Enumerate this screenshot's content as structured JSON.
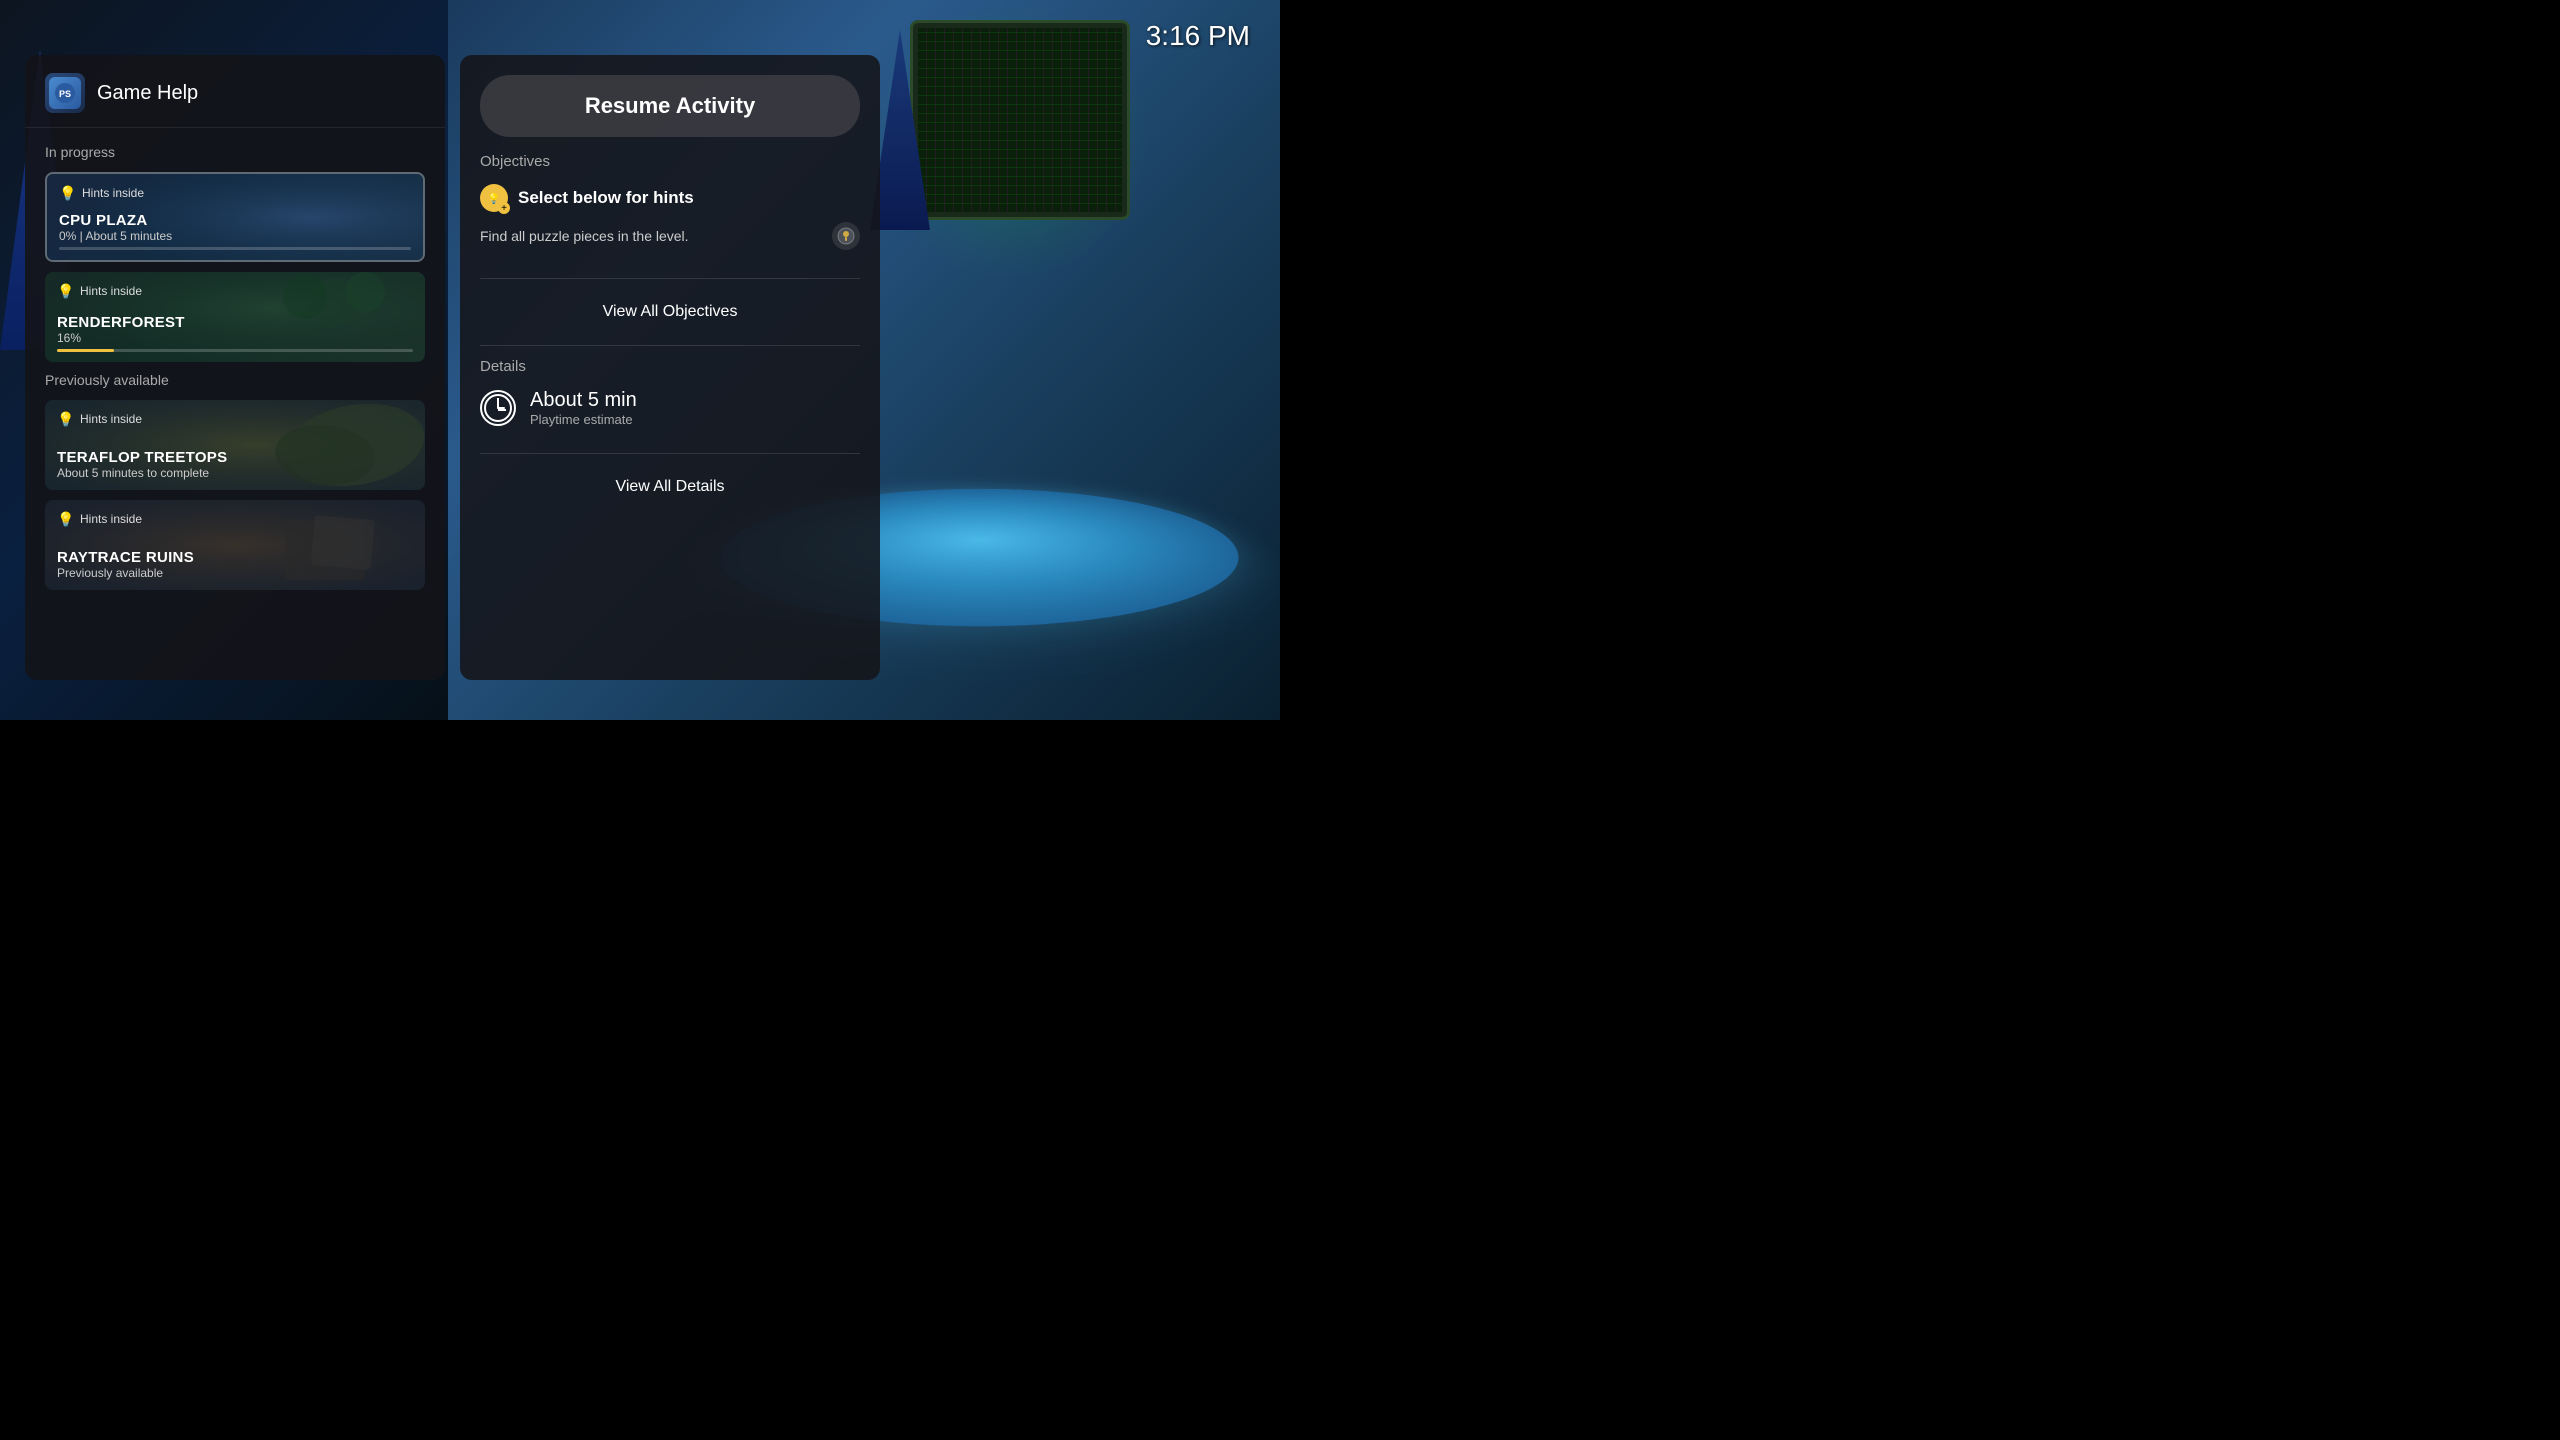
{
  "time": "3:16 PM",
  "header": {
    "title": "Game Help",
    "icon_label": "PS"
  },
  "resume_button": "Resume Activity",
  "in_progress_label": "In progress",
  "previously_available_label": "Previously available",
  "activities_in_progress": [
    {
      "id": "cpu-plaza",
      "hints_label": "Hints inside",
      "name": "CPU PLAZA",
      "progress_text": "0%  |  About 5 minutes",
      "progress_pct": 0,
      "bg": "cpu"
    },
    {
      "id": "renderforest",
      "hints_label": "Hints inside",
      "name": "RENDERFOREST",
      "progress_text": "16%",
      "progress_pct": 16,
      "bg": "render"
    }
  ],
  "activities_prev": [
    {
      "id": "teraflop",
      "hints_label": "Hints inside",
      "name": "TERAFLOP TREETOPS",
      "sub": "About 5 minutes to complete",
      "bg": "teraflop"
    },
    {
      "id": "raytrace",
      "hints_label": "Hints inside",
      "name": "RAYTRACE RUINS",
      "sub": "Previously available",
      "bg": "raytrace"
    }
  ],
  "detail": {
    "objectives_label": "Objectives",
    "objective_title": "Select below for hints",
    "objective_desc": "Find all puzzle pieces in the level.",
    "view_all_objectives": "View All Objectives",
    "details_label": "Details",
    "playtime_amount": "About 5 min",
    "playtime_label": "Playtime estimate",
    "view_all_details": "View All Details"
  }
}
